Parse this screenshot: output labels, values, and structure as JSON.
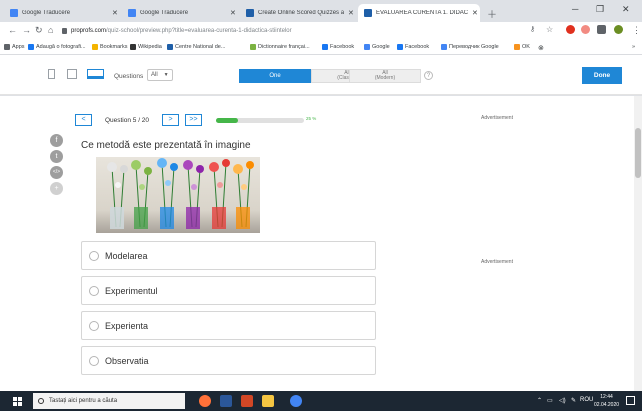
{
  "browser": {
    "tabs": [
      {
        "title": "Google Traducere",
        "color": "#4285f4"
      },
      {
        "title": "Google Traducere",
        "color": "#4285f4"
      },
      {
        "title": "Create Online Scored Quizzes an",
        "color": "#1f5fa8"
      },
      {
        "title": "EVALUAREA CURENTA 1. DIDACTI",
        "color": "#1f5fa8"
      }
    ],
    "url_host": "proprofs.com",
    "url_rest": "/quiz-school/preview.php?title=evaluarea-curenta-1-didactica-stiintelor",
    "bookmarks": [
      {
        "label": "Apps",
        "color": "#5f6368"
      },
      {
        "label": "Adaugă o fotografi...",
        "color": "#1877f2"
      },
      {
        "label": "Bookmarks",
        "color": "#f4b400"
      },
      {
        "label": "Wikipedia",
        "color": "#333333"
      },
      {
        "label": "Centre National de...",
        "color": "#1f5fa8"
      },
      {
        "label": "Dictionnaire françai...",
        "color": "#7cb342"
      },
      {
        "label": "Facebook",
        "color": "#1877f2"
      },
      {
        "label": "Google",
        "color": "#4285f4"
      },
      {
        "label": "Facebook",
        "color": "#1877f2"
      },
      {
        "label": "Переводчик Google",
        "color": "#4285f4"
      },
      {
        "label": "OK",
        "color": "#f7931e"
      }
    ]
  },
  "toolbar": {
    "questions_label": "Questions",
    "questions_filter": "All",
    "modes": [
      {
        "label": "One",
        "sub": "",
        "active": true
      },
      {
        "label": "All",
        "sub": "(Classic)",
        "active": false
      },
      {
        "label": "All",
        "sub": "(Modern)",
        "active": false
      }
    ],
    "help": "?",
    "done_label": "Done"
  },
  "quiz": {
    "prev": "<",
    "counter": "Question 5 / 20",
    "next": ">",
    "last": ">>",
    "progress_pct": 25,
    "progress_text": "25 %",
    "question": "Ce metodă este prezentată în imagine",
    "answers": [
      "Modelarea",
      "Experimentul",
      "Experienta",
      "Observatia"
    ]
  },
  "share_icons": [
    "f",
    "t",
    "</>",
    "+"
  ],
  "ads": {
    "label_top": "Advertisement",
    "label_mid": "Advertisement"
  },
  "taskbar": {
    "search_placeholder": "Tastați aici pentru a căuta",
    "lang": "ROU",
    "time": "12:44",
    "date": "02.04.2020"
  },
  "colors": {
    "accent": "#1f87d6",
    "progress": "#45b649"
  }
}
